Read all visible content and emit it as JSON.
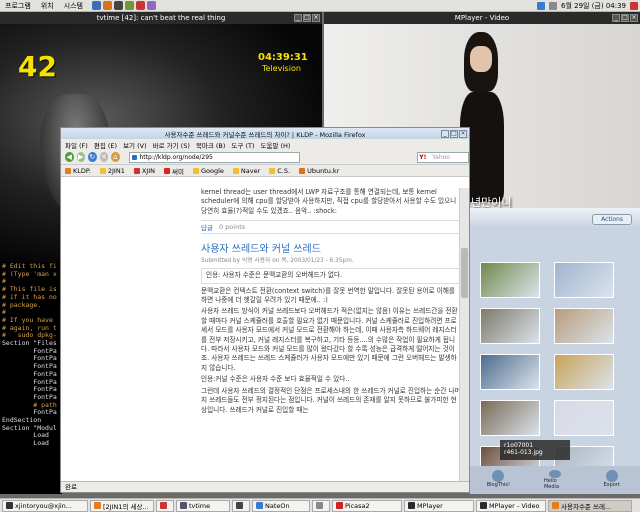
{
  "top_panel": {
    "menus": [
      "프로그램",
      "위치",
      "시스템"
    ],
    "datetime": "6월 29일 (금) 04:39"
  },
  "tvtime": {
    "title": "tvtime [42]: can't beat the real thing",
    "channel": "42",
    "clock": "04:39:31",
    "station": "Television"
  },
  "mplayer": {
    "title": "MPlayer - Video",
    "subtitle": "2년만이니"
  },
  "terminal": {
    "lines": [
      {
        "t": "# Edit this fi",
        "k": "c"
      },
      {
        "t": "# (Type 'man x",
        "k": "c"
      },
      {
        "t": "#",
        "k": "c"
      },
      {
        "t": "# This file is",
        "k": "c"
      },
      {
        "t": "# if it has no",
        "k": "c"
      },
      {
        "t": "# package.",
        "k": "c"
      },
      {
        "t": "#",
        "k": "c"
      },
      {
        "t": "# If you have",
        "k": "c"
      },
      {
        "t": "# again, run t",
        "k": "c"
      },
      {
        "t": "#   sudo dpkg-",
        "k": "c"
      },
      {
        "t": "",
        "k": "s"
      },
      {
        "t": "Section \"Files",
        "k": "s"
      },
      {
        "t": "        FontPa",
        "k": "s"
      },
      {
        "t": "        FontPa",
        "k": "s"
      },
      {
        "t": "        FontPa",
        "k": "s"
      },
      {
        "t": "        FontPa",
        "k": "s"
      },
      {
        "t": "        FontPa",
        "k": "s"
      },
      {
        "t": "        FontPa",
        "k": "s"
      },
      {
        "t": "        FontPa",
        "k": "s"
      },
      {
        "t": "        # path",
        "k": "c"
      },
      {
        "t": "        FontPa",
        "k": "s"
      },
      {
        "t": "EndSection",
        "k": "s"
      },
      {
        "t": "",
        "k": "s"
      },
      {
        "t": "Section \"Modul",
        "k": "s"
      },
      {
        "t": "        Load",
        "k": "s"
      },
      {
        "t": "        Load",
        "k": "s"
      }
    ]
  },
  "firefox": {
    "title": "사용자수준 쓰레드와 커널수준 쓰레드의 차이? | KLDP - Mozilla Firefox",
    "menus": [
      "파일 (F)",
      "편집 (E)",
      "보기 (V)",
      "바로 가기 (S)",
      "북마크 (B)",
      "도구 (T)",
      "도움말 (H)"
    ],
    "url": "http://kldp.org/node/295",
    "search_placeholder": "Yahoo",
    "bookmarks": [
      "KLDP.",
      "2JIN1",
      "XJIN",
      "써미",
      "Google",
      "Naver",
      "C.S.",
      "Ubuntu.kr"
    ],
    "status": "완료",
    "content": {
      "prev_text": "kernel thread는 user thread에서 LWP 자료구조를 통해 연결되는데, 보통 kernel scheduler에 의해 cpu를 할당받아 사용하지만, 직접 cpu를 할당받아서 사용할 수도 있으니 당연히 효율(?)적일 수도 있겠죠.. 음악.. :shock:",
      "reply_label": "답글",
      "points": "0 points",
      "post_title": "사용자 쓰레드와 커널 쓰레드",
      "post_meta": "Submitted by 익명 사용자 on 목, 2003/01/23 - 6:35pm.",
      "quote": "인용: 사용자 수준은 문맥교환의 오버헤드가 없다.",
      "p1": "문맥교환은 컨텍스트 전환(context switch)를 잘못 번역한 말입니다. 잘못된 용어로 이해를 하면 나중에 더 헷갈릴 우려가 있기 때문에.. :)",
      "p2": "사용자 쓰레드 방식이 커널 쓰레드보다 오버헤드가 적은(없지는 않음) 이유는 쓰레드간을 전환할 때마다 커널 스케쥴러를 호출할 필요가 없기 때문입니다. 커널 스케쥴러로 진입하려면 프로세서 모드를 사용자 모드에서 커널 모드로 전환해야 하는데, 이때 사용자측 하드웨어 레지스터를 전부 저장시키고, 커널 레지스터를 복구하고, 기타 등등....의 수많은 작업이 필요하게 됩니다. 따라서 사용자 모드와 커널 모드를 많이 왔다갔다 할 수록 성능은 급격하게 떨어지는 것이죠. 사용자 쓰레드는 쓰레드 스케쥴러가 사용자 모드에만 있기 때문에 그런 오버헤드는 발생하지 않습니다.",
      "p3": "인용:커널 수준은 사용자 수준 보다 효율적일 수 있다..",
      "p4": "그런데 사용자 쓰레드의 결정적인 단점은 프로세스내의 한 쓰레드가 커널로 진입하는 순간 나머지 쓰레드들도 전부 정지된다는 점입니다. 커널이 쓰레드의 존재를 알지 못하므로 불가피한 현상입니다. 쓰레드가 커널로 진입할 때는"
    }
  },
  "picasa": {
    "actions_label": "Actions",
    "tip_name": "r1o07001",
    "tip_file": "r461-013.jpg",
    "tools": [
      "BlogThis!",
      "Hello Media",
      "Export"
    ],
    "thumb_colors": [
      "#6f8a4c",
      "#9fb5d0",
      "#7e7a6a",
      "#b89d7c",
      "#4d6d8f",
      "#c8a35a",
      "#7a6a55",
      "#d9d9e6",
      "#6c4f3a",
      "#a9b6c2",
      "#5f7d5a",
      "#8a8a8a"
    ]
  },
  "taskbar": {
    "items": [
      {
        "label": "xjintoryou@xjin...",
        "color": "#333",
        "active": false
      },
      {
        "label": "[2JIN1의 세상...",
        "color": "#e47d1f",
        "active": false
      },
      {
        "label": "",
        "color": "#c33",
        "active": false
      },
      {
        "label": "tvtime",
        "color": "#556",
        "active": false
      },
      {
        "label": "",
        "color": "#444",
        "active": false
      },
      {
        "label": "NateOn",
        "color": "#3a7ad0",
        "active": false
      },
      {
        "label": "",
        "color": "#888",
        "active": false
      },
      {
        "label": "Picasa2",
        "color": "#c22",
        "active": false
      },
      {
        "label": "MPlayer",
        "color": "#2a2a2a",
        "active": false
      },
      {
        "label": "MPlayer - Video",
        "color": "#2a2a2a",
        "active": false
      },
      {
        "label": "사용자수준 쓰레...",
        "color": "#e47d1f",
        "active": true
      }
    ]
  },
  "colors": {
    "tv_osd": "#f6e200",
    "link_blue": "#2a6cbf",
    "terminal_comment": "#d9a14a"
  }
}
